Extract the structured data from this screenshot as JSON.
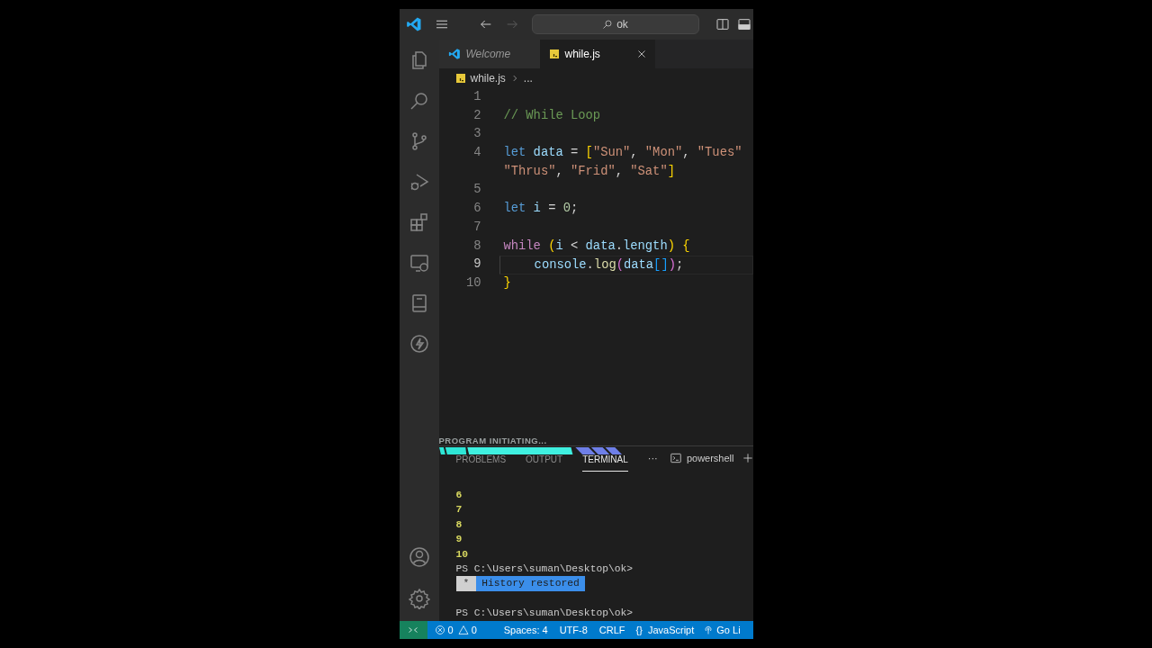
{
  "title_bar": {
    "search": "ok",
    "back_enabled": true,
    "forward_enabled": false
  },
  "tabs": [
    {
      "label": "Welcome",
      "kind": "welcome",
      "selected": false,
      "preview": true
    },
    {
      "label": "while.js",
      "kind": "js",
      "selected": true,
      "preview": false
    }
  ],
  "breadcrumb": {
    "file": "while.js",
    "rest": "..."
  },
  "editor": {
    "lines": [
      {
        "number": "1"
      },
      {
        "number": "2",
        "tokens": [
          {
            "text": "// While Loop",
            "kind": "comment"
          }
        ]
      },
      {
        "number": "3"
      },
      {
        "number": "4",
        "tokens": [
          {
            "text": "let",
            "kind": "keyword"
          },
          {
            "text": " data",
            "kind": "variable"
          },
          {
            "text": " = ",
            "kind": "plain"
          },
          {
            "text": "[",
            "kind": "bracket"
          },
          {
            "text": "\"Sun\"",
            "kind": "string"
          },
          {
            "text": ", ",
            "kind": "plain"
          },
          {
            "text": "\"Mon\"",
            "kind": "string"
          },
          {
            "text": ", ",
            "kind": "plain"
          },
          {
            "text": "\"Tues\"",
            "kind": "string"
          }
        ],
        "wrapped": {
          "tokens": [
            {
              "text": "\"Thrus\"",
              "kind": "string"
            },
            {
              "text": ", ",
              "kind": "plain"
            },
            {
              "text": "\"Frid\"",
              "kind": "string"
            },
            {
              "text": ", ",
              "kind": "plain"
            },
            {
              "text": "\"Sat\"",
              "kind": "string"
            },
            {
              "text": "]",
              "kind": "bracket"
            }
          ]
        }
      },
      {
        "number": "5"
      },
      {
        "number": "6",
        "tokens": [
          {
            "text": "let",
            "kind": "keyword"
          },
          {
            "text": " i",
            "kind": "variable"
          },
          {
            "text": " = ",
            "kind": "plain"
          },
          {
            "text": "0",
            "kind": "number"
          },
          {
            "text": ";",
            "kind": "plain"
          }
        ]
      },
      {
        "number": "7"
      },
      {
        "number": "8",
        "tokens": [
          {
            "text": "while",
            "kind": "control"
          },
          {
            "text": " (",
            "kind": "bracket"
          },
          {
            "text": "i",
            "kind": "variable"
          },
          {
            "text": " < ",
            "kind": "plain"
          },
          {
            "text": "data",
            "kind": "variable"
          },
          {
            "text": ".",
            "kind": "plain"
          },
          {
            "text": "length",
            "kind": "variable"
          },
          {
            "text": ")",
            "kind": "bracket"
          },
          {
            "text": " {",
            "kind": "bracket"
          }
        ]
      },
      {
        "number": "9",
        "current": true,
        "tokens": [
          {
            "text": "    console",
            "kind": "variable"
          },
          {
            "text": ".",
            "kind": "plain"
          },
          {
            "text": "log",
            "kind": "function"
          },
          {
            "text": "(",
            "kind": "bracket2"
          },
          {
            "text": "data",
            "kind": "variable"
          },
          {
            "text": "[]",
            "kind": "bracket3"
          },
          {
            "text": ")",
            "kind": "bracket2"
          },
          {
            "text": ";",
            "kind": "plain"
          }
        ]
      },
      {
        "number": "10",
        "tokens": [
          {
            "text": "}",
            "kind": "bracket"
          }
        ]
      }
    ]
  },
  "overlay": {
    "text": "PROGRAM INITIATING..."
  },
  "panel": {
    "tabs": [
      {
        "label": "PROBLEMS",
        "selected": false
      },
      {
        "label": "OUTPUT",
        "selected": false
      },
      {
        "label": "TERMINAL",
        "selected": true
      }
    ],
    "more": "···",
    "terminal_name": "powershell"
  },
  "terminal": [
    {
      "text": "6",
      "kind": "output"
    },
    {
      "text": "7",
      "kind": "output"
    },
    {
      "text": "8",
      "kind": "output"
    },
    {
      "text": "9",
      "kind": "output"
    },
    {
      "text": "10",
      "kind": "output"
    },
    {
      "text": "PS C:\\Users\\suman\\Desktop\\ok>",
      "kind": "prompt"
    },
    {
      "kind": "badge",
      "mark": "*",
      "text": "History restored"
    },
    {
      "kind": "blank"
    },
    {
      "text": "PS C:\\Users\\suman\\Desktop\\ok>",
      "kind": "prompt"
    }
  ],
  "status_bar": {
    "errors": "0",
    "warnings": "0",
    "items": [
      "Spaces: 4",
      "UTF-8",
      "CRLF"
    ],
    "language_icon": "{}",
    "language": "JavaScript",
    "live": "Go Li"
  }
}
